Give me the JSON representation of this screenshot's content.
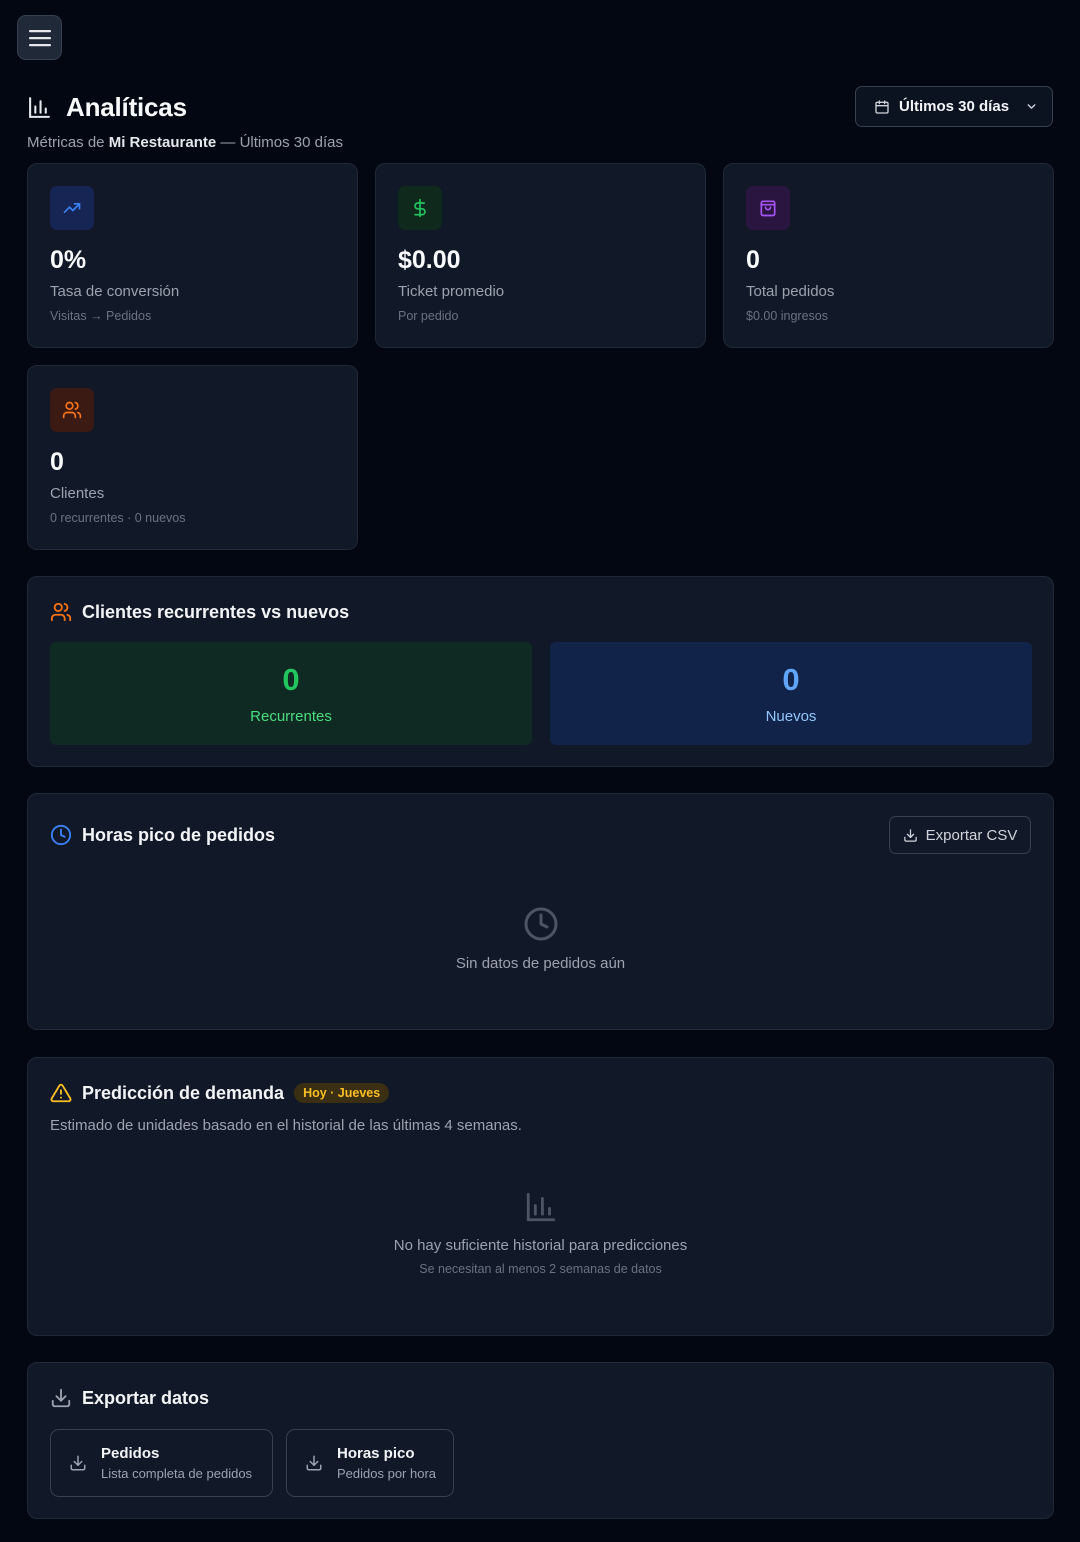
{
  "header": {
    "title": "Analíticas",
    "subtitle_prefix": "Métricas de",
    "restaurant": "Mi Restaurante",
    "subtitle_suffix": "— Últimos 30 días",
    "range_label": "Últimos 30 días"
  },
  "stats": [
    {
      "value": "0%",
      "label": "Tasa de conversión",
      "sub": "Visitas → Pedidos",
      "icon": "trending-up-icon",
      "color": "#3b82f6"
    },
    {
      "value": "$0.00",
      "label": "Ticket promedio",
      "sub": "Por pedido",
      "icon": "dollar-icon",
      "color": "#22c55e"
    },
    {
      "value": "0",
      "label": "Total pedidos",
      "sub": "$0.00 ingresos",
      "icon": "shopping-bag-icon",
      "color": "#a855f7"
    },
    {
      "value": "0",
      "label": "Clientes",
      "sub": "0 recurrentes · 0 nuevos",
      "icon": "users-icon",
      "color": "#f97316"
    }
  ],
  "recurring": {
    "title": "Clientes recurrentes vs nuevos",
    "recurring_value": "0",
    "recurring_label": "Recurrentes",
    "new_value": "0",
    "new_label": "Nuevos"
  },
  "peak": {
    "title": "Horas pico de pedidos",
    "export_label": "Exportar CSV",
    "empty_message": "Sin datos de pedidos aún"
  },
  "prediction": {
    "title": "Predicción de demanda",
    "badge": "Hoy · Jueves",
    "description": "Estimado de unidades basado en el historial de las últimas 4 semanas.",
    "empty_message": "No hay suficiente historial para predicciones",
    "empty_sub": "Se necesitan al menos 2 semanas de datos"
  },
  "export": {
    "title": "Exportar datos",
    "buttons": [
      {
        "title": "Pedidos",
        "sub": "Lista completa de pedidos"
      },
      {
        "title": "Horas pico",
        "sub": "Pedidos por hora"
      }
    ]
  },
  "colors": {
    "background": "#030712",
    "card": "#111827",
    "accent_green": "#22c55e",
    "accent_blue": "#3b82f6",
    "accent_orange": "#f97316",
    "accent_yellow": "#fbbf24"
  }
}
